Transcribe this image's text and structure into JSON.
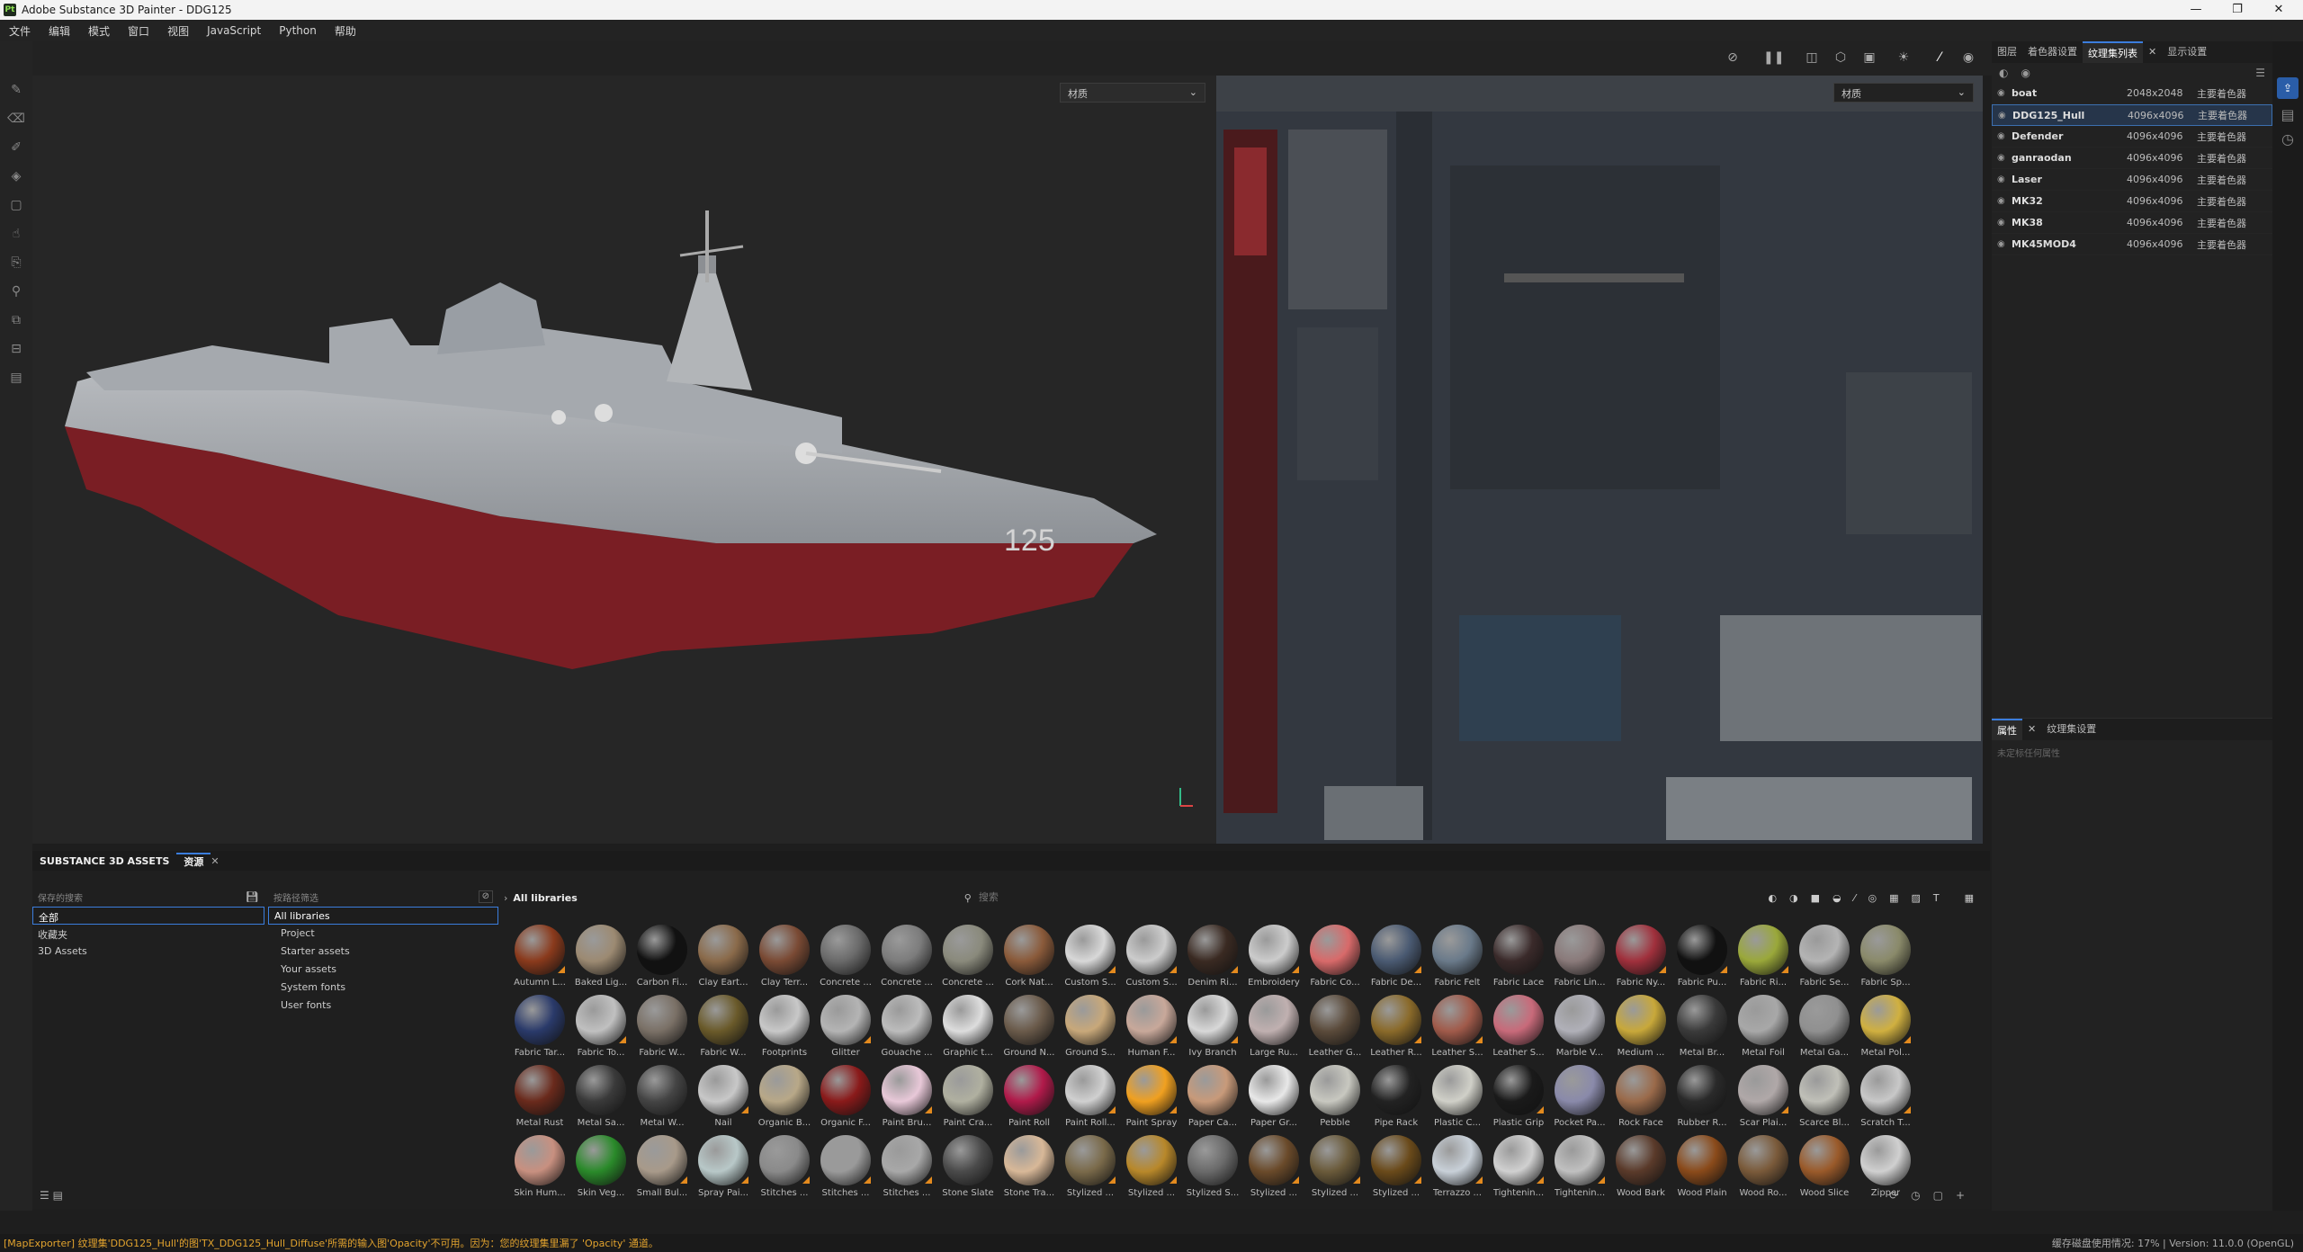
{
  "window": {
    "title": "Adobe Substance 3D Painter - DDG125",
    "app_icon": "Pt",
    "controls": [
      "—",
      "❐",
      "✕"
    ]
  },
  "menu": [
    "文件",
    "编辑",
    "模式",
    "窗口",
    "视图",
    "JavaScript",
    "Python",
    "帮助"
  ],
  "viewport": {
    "dropdown_3d": "材质",
    "dropdown_2d": "材质",
    "hull_number": "125"
  },
  "right_panel": {
    "tabs": [
      "图层",
      "着色器设置",
      "纹理集列表",
      "显示设置"
    ],
    "active_tab": "纹理集列表",
    "texture_sets": [
      {
        "name": "boat",
        "size": "2048x2048",
        "shader": "主要着色器"
      },
      {
        "name": "DDG125_Hull",
        "size": "4096x4096",
        "shader": "主要着色器",
        "selected": true
      },
      {
        "name": "Defender",
        "size": "4096x4096",
        "shader": "主要着色器"
      },
      {
        "name": "ganraodan",
        "size": "4096x4096",
        "shader": "主要着色器"
      },
      {
        "name": "Laser",
        "size": "4096x4096",
        "shader": "主要着色器"
      },
      {
        "name": "MK32",
        "size": "4096x4096",
        "shader": "主要着色器"
      },
      {
        "name": "MK38",
        "size": "4096x4096",
        "shader": "主要着色器"
      },
      {
        "name": "MK45MOD4",
        "size": "4096x4096",
        "shader": "主要着色器"
      }
    ],
    "props_tabs": [
      "属性",
      "纹理集设置"
    ],
    "props_empty": "未定标任何属性"
  },
  "assets": {
    "panel_title": "SUBSTANCE 3D ASSETS",
    "tab": "资源",
    "saved_header": "保存的搜索",
    "saved_items": [
      "全部",
      "收藏夹",
      "3D Assets"
    ],
    "lib_header": "按路径筛选",
    "lib_items": [
      "All libraries",
      "Project",
      "Starter assets",
      "Your assets",
      "System fonts",
      "User fonts"
    ],
    "breadcrumb": "All libraries",
    "search_placeholder": "搜索",
    "materials": [
      "Autumn L...",
      "Baked Lig...",
      "Carbon Fi...",
      "Clay Eart...",
      "Clay Terr...",
      "Concrete ...",
      "Concrete ...",
      "Concrete ...",
      "Cork Nat...",
      "Custom S...",
      "Custom S...",
      "Denim Ri...",
      "Embroidery",
      "Fabric Co...",
      "Fabric De...",
      "Fabric Felt",
      "Fabric Lace",
      "Fabric Lin...",
      "Fabric Ny...",
      "Fabric Pu...",
      "Fabric Ri...",
      "Fabric Se...",
      "Fabric Sp...",
      "Fabric Tar...",
      "Fabric To...",
      "Fabric W...",
      "Fabric W...",
      "Footprints",
      "Glitter",
      "Gouache ...",
      "Graphic t...",
      "Ground N...",
      "Ground S...",
      "Human F...",
      "Ivy Branch",
      "Large Ru...",
      "Leather G...",
      "Leather R...",
      "Leather S...",
      "Leather S...",
      "Marble V...",
      "Medium ...",
      "Metal Br...",
      "Metal Foil",
      "Metal Ga...",
      "Metal Pol...",
      "Metal Rust",
      "Metal Sa...",
      "Metal W...",
      "Nail",
      "Organic B...",
      "Organic F...",
      "Paint Bru...",
      "Paint Cra...",
      "Paint Roll",
      "Paint Roll...",
      "Paint Spray",
      "Paper Ca...",
      "Paper Gr...",
      "Pebble",
      "Pipe Rack",
      "Plastic C...",
      "Plastic Grip",
      "Pocket Pa...",
      "Rock Face",
      "Rubber R...",
      "Scar Plai...",
      "Scarce Bl...",
      "Scratch T...",
      "Skin Hum...",
      "Skin Veg...",
      "Small Bul...",
      "Spray Pai...",
      "Stitches ...",
      "Stitches ...",
      "Stitches ...",
      "Stone Slate",
      "Stone Tra...",
      "Stylized ...",
      "Stylized ...",
      "Stylized S...",
      "Stylized ...",
      "Stylized ...",
      "Stylized ...",
      "Terrazzo ...",
      "Tightenin...",
      "Tightenin...",
      "Wood Bark",
      "Wood Plain",
      "Wood Ro...",
      "Wood Slice",
      "Zipper"
    ],
    "colors": [
      "#8a3a1c",
      "#9c8a72",
      "#111111",
      "#8a6a4a",
      "#7a4a34",
      "#6a6a6a",
      "#7c7c7c",
      "#8a8a7c",
      "#8a5a3a",
      "#d8d8d8",
      "#cccccc",
      "#3a2a22",
      "#cccccc",
      "#d86a6a",
      "#4a5a72",
      "#6a7a8a",
      "#3a2a2a",
      "#8a7a7a",
      "#a0303c",
      "#111111",
      "#9aa83a",
      "#b4b4b4",
      "#8a8a6a",
      "#2a3a6a",
      "#c0c0c0",
      "#7a7066",
      "#6a5a2a",
      "#c8c8c8",
      "#b4b4b4",
      "#bcbcbc",
      "#dddddd",
      "#6a5a4a",
      "#c8a87a",
      "#c8a89a",
      "#d8d8d8",
      "#c0b0b0",
      "#5a4a3a",
      "#8a6a2a",
      "#a05a4a",
      "#c86a7a",
      "#b0b0b8",
      "#c8a83a",
      "#3a3a3a",
      "#a8a8a8",
      "#909090",
      "#d0b040",
      "#6a2a1c",
      "#3a3a3a",
      "#444444",
      "#c8c8c8",
      "#b8a888",
      "#8a1a1a",
      "#e8c8d8",
      "#b0b0a0",
      "#b01a4a",
      "#d0d0d0",
      "#f0a020",
      "#c89a7a",
      "#e8e8e8",
      "#c8c8c0",
      "#222222",
      "#d0d0c8",
      "#1a1a1a",
      "#8a8aaa",
      "#9a6a4a",
      "#2a2a2a",
      "#b0a8a8",
      "#c0c0b8",
      "#c8c8c8",
      "#c89080",
      "#2a8a2a",
      "#a89a8a",
      "#b8c8c8",
      "#8a8a8a",
      "#9a9a9a",
      "#a8a8a8",
      "#4a4a4a",
      "#d8b898",
      "#7a6a4a",
      "#b8882a",
      "#6a6a6a",
      "#6a4a2a",
      "#6a5a3a",
      "#6a4a1a",
      "#c8d0d8",
      "#d0d0d0",
      "#c0c0c0",
      "#5a3a2a",
      "#8a4a1a",
      "#7a5a3a",
      "#9a5a2a",
      "#d0d0d0"
    ]
  },
  "status": {
    "message": "[MapExporter] 纹理集'DDG125_Hull'的图'TX_DDG125_Hull_Diffuse'所需的输入图'Opacity'不可用。因为：您的纹理集里漏了 'Opacity' 通道。",
    "right": "缓存磁盘使用情况:      17% | Version: 11.0.0 (OpenGL)"
  }
}
